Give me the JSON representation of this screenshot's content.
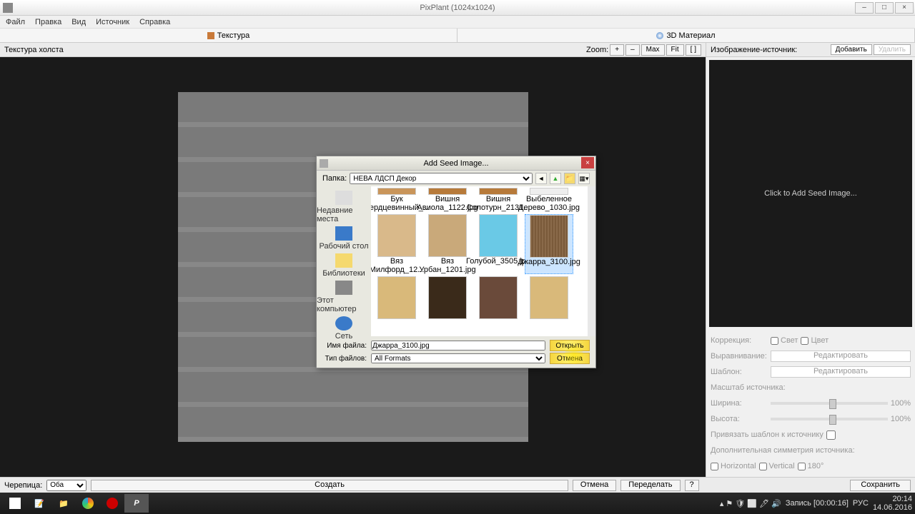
{
  "titlebar": {
    "title": "PixPlant (1024x1024)"
  },
  "menu": {
    "file": "Файл",
    "edit": "Правка",
    "view": "Вид",
    "source": "Источник",
    "help": "Справка"
  },
  "tabs": {
    "texture": "Текстура",
    "material": "3D Материал"
  },
  "toolbar": {
    "canvas_label": "Текстура холста",
    "zoom": "Zoom:",
    "plus": "+",
    "minus": "–",
    "max": "Max",
    "fit": "Fit",
    "one": "[ ]"
  },
  "right": {
    "header": "Изображение-источник:",
    "add": "Добавить",
    "del": "Удалить",
    "seed_prompt": "Click to Add Seed Image...",
    "correction": "Коррекция:",
    "light": "Свет",
    "color": "Цвет",
    "align": "Выравнивание:",
    "edit": "Редактировать",
    "template": "Шаблон:",
    "scale": "Масштаб источника:",
    "width": "Ширина:",
    "height": "Высота:",
    "pct": "100%",
    "bind": "Привязать шаблон к источнику",
    "symm": "Дополнительная симметрия источника:",
    "horiz": "Horizontal",
    "vert": "Vertical",
    "d180": "180°"
  },
  "bottom": {
    "tile": "Черепица:",
    "tile_val": "Оба",
    "create": "Создать",
    "cancel": "Отмена",
    "redo": "Переделать",
    "help": "?",
    "save": "Сохранить"
  },
  "dialog": {
    "title": "Add Seed Image...",
    "folder_label": "Папка:",
    "folder": "НЕВА ЛДСП Декор",
    "sidebar": {
      "recent": "Недавние места",
      "desktop": "Рабочий стол",
      "libs": "Библиотеки",
      "pc": "Этот компьютер",
      "net": "Сеть"
    },
    "files_top": [
      "Бук Сердцевинный_...",
      "Вишня Авиола_1122.jpg",
      "Вишня Солотурн_2131...",
      "Выбеленное Дерево_1030.jpg"
    ],
    "files_mid": [
      "Вяз Милфорд_12...",
      "Вяз Урбан_1201.jpg",
      "Голубой_3505.jpg",
      "Джарра_3100.jpg"
    ],
    "filename_label": "Имя файла:",
    "filename": "Джарра_3100.jpg",
    "filetype_label": "Тип файлов:",
    "filetype": "All Formats",
    "open": "Открыть",
    "cancel": "Отмена"
  },
  "taskbar": {
    "rec": "Запись [00:00:16]",
    "lang": "РУС",
    "time": "20:14",
    "date": "14.06.2016"
  }
}
